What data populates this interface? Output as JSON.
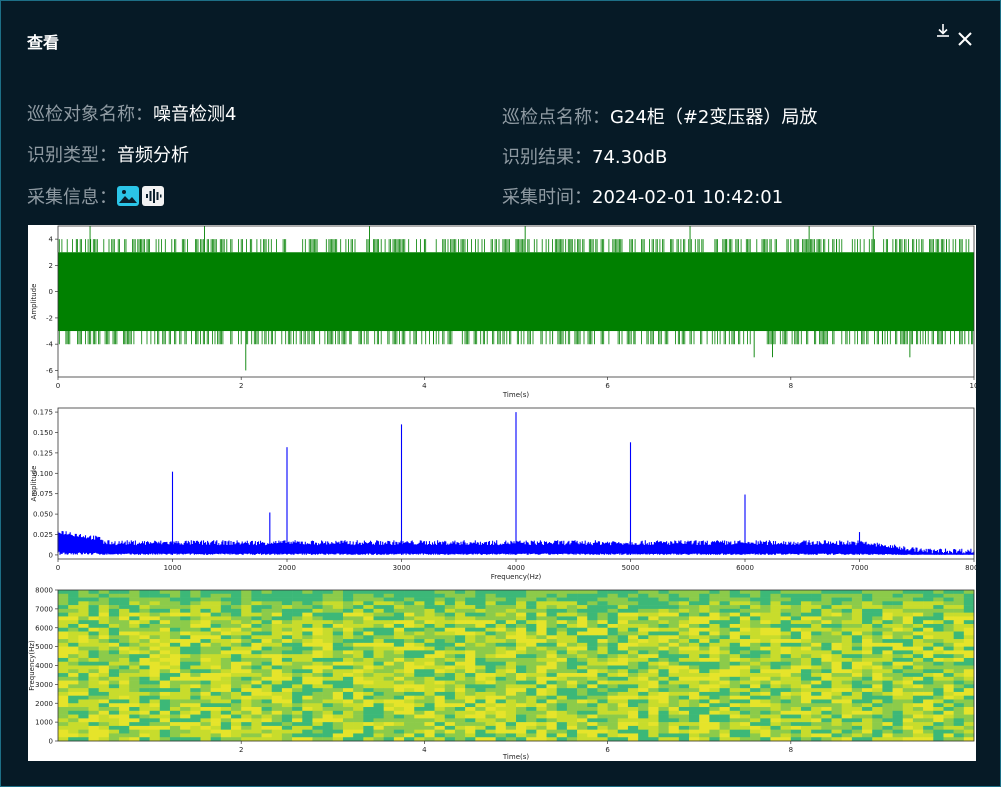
{
  "dialog": {
    "title": "查看"
  },
  "info": {
    "object_name_label": "巡检对象名称：",
    "object_name_value": "噪音检测4",
    "point_name_label": "巡检点名称：",
    "point_name_value": "G24柜（#2变压器）局放",
    "type_label": "识别类型：",
    "type_value": "音频分析",
    "result_label": "识别结果：",
    "result_value": "74.30dB",
    "collect_info_label": "采集信息：",
    "collect_time_label": "采集时间：",
    "collect_time_value": "2024-02-01 10:42:01"
  },
  "icons": {
    "download": "download-icon",
    "close": "close-icon",
    "image": "image-icon",
    "audio": "audio-icon"
  },
  "colors": {
    "background": "#061a26",
    "label": "#8f9aa2",
    "value": "#ffffff",
    "accent": "#2bc5e8",
    "waveform": "#008000",
    "spectrum": "#0000ff"
  },
  "chart_data": [
    {
      "type": "line",
      "xlabel": "Time(s)",
      "ylabel": "Amplitude",
      "xlim": [
        0,
        10
      ],
      "ylim": [
        -6.5,
        5
      ],
      "xticks": [
        0,
        2,
        4,
        6,
        8,
        10
      ],
      "yticks": [
        -6,
        -4,
        -2,
        0,
        2,
        4
      ],
      "series": [
        {
          "color": "#008000",
          "band_min": -3,
          "band_max": 3,
          "peaks_up": [
            [
              0.2,
              4
            ],
            [
              0.35,
              5
            ],
            [
              0.9,
              4
            ],
            [
              1.6,
              5
            ],
            [
              2.1,
              4
            ],
            [
              3.4,
              5
            ],
            [
              4.0,
              4
            ],
            [
              5.0,
              4
            ],
            [
              5.1,
              5
            ],
            [
              5.6,
              4
            ],
            [
              6.9,
              5
            ],
            [
              7.3,
              4
            ],
            [
              8.2,
              5
            ],
            [
              8.5,
              4
            ],
            [
              8.9,
              5
            ],
            [
              9.7,
              4
            ]
          ],
          "peaks_down": [
            [
              0.1,
              -4
            ],
            [
              2.05,
              -6
            ],
            [
              3.2,
              -4
            ],
            [
              4.1,
              -4
            ],
            [
              5.4,
              -4
            ],
            [
              6.3,
              -4
            ],
            [
              7.6,
              -5
            ],
            [
              7.8,
              -5
            ],
            [
              9.0,
              -4
            ],
            [
              9.3,
              -5
            ],
            [
              9.9,
              -4
            ]
          ]
        }
      ]
    },
    {
      "type": "line",
      "xlabel": "Frequency(Hz)",
      "ylabel": "Amplitude",
      "xlim": [
        0,
        8000
      ],
      "ylim": [
        -0.005,
        0.18
      ],
      "xticks": [
        0,
        1000,
        2000,
        3000,
        4000,
        5000,
        6000,
        7000,
        8000
      ],
      "yticks": [
        0.0,
        0.025,
        0.05,
        0.075,
        0.1,
        0.125,
        0.15,
        0.175
      ],
      "series": [
        {
          "color": "#0000ff",
          "noise_floor": 0.012,
          "peaks": [
            [
              1000,
              0.102
            ],
            [
              1850,
              0.052
            ],
            [
              2000,
              0.132
            ],
            [
              3000,
              0.16
            ],
            [
              4000,
              0.175
            ],
            [
              5000,
              0.138
            ],
            [
              6000,
              0.074
            ],
            [
              7000,
              0.028
            ]
          ]
        }
      ]
    },
    {
      "type": "heatmap",
      "xlabel": "Time(s)",
      "ylabel": "Frequency(Hz)",
      "xlim": [
        0,
        10
      ],
      "ylim": [
        0,
        8000
      ],
      "xticks": [
        2,
        4,
        6,
        8
      ],
      "yticks": [
        0,
        1000,
        2000,
        3000,
        4000,
        5000,
        6000,
        7000,
        8000
      ],
      "colormap": [
        "#3cb878",
        "#8ccb4a",
        "#c8dc2c",
        "#e6e42a"
      ]
    }
  ]
}
